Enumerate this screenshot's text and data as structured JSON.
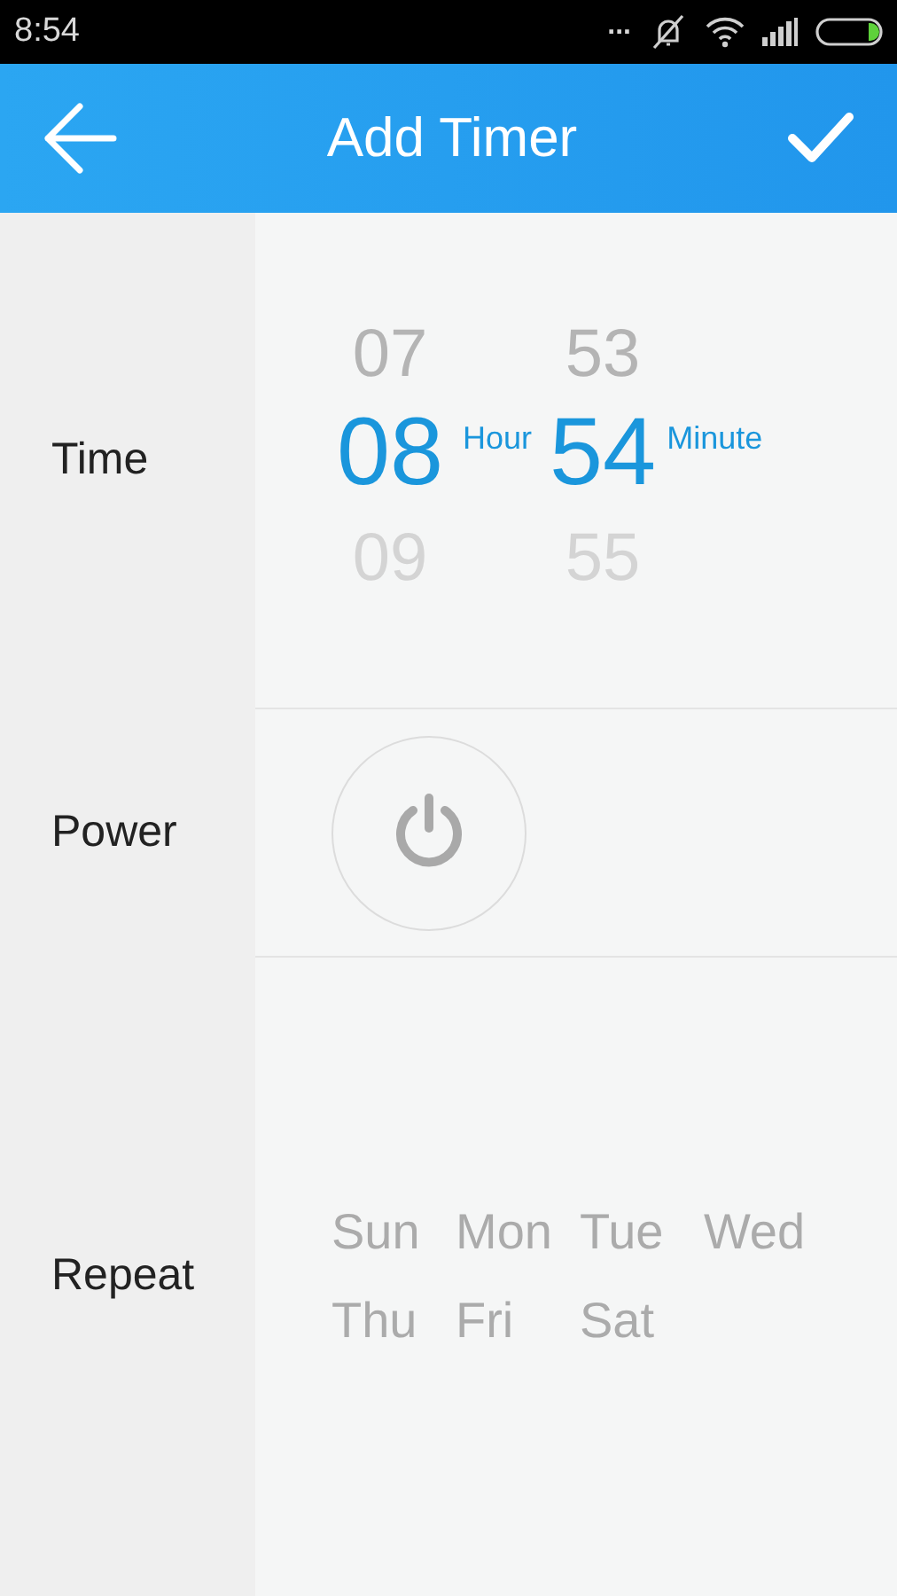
{
  "status_bar": {
    "time": "8:54",
    "more": "..."
  },
  "header": {
    "title": "Add Timer"
  },
  "sections": [
    {
      "kind": "time",
      "label": "Time",
      "columns": [
        {
          "unit": "Hour",
          "items": [
            {
              "text": "07",
              "selected": false
            },
            {
              "text": "08",
              "selected": true
            },
            {
              "text": "09",
              "selected": false
            }
          ]
        },
        {
          "unit": "Minute",
          "items": [
            {
              "text": "53",
              "selected": false
            },
            {
              "text": "54",
              "selected": true
            },
            {
              "text": "55",
              "selected": false
            }
          ]
        }
      ]
    },
    {
      "kind": "power",
      "label": "Power",
      "on": false
    },
    {
      "kind": "repeat",
      "label": "Repeat",
      "days": [
        {
          "text": "Sun",
          "selected": false
        },
        {
          "text": "Mon",
          "selected": false
        },
        {
          "text": "Tue",
          "selected": false
        },
        {
          "text": "Wed",
          "selected": false
        },
        {
          "text": "Thu",
          "selected": false
        },
        {
          "text": "Fri",
          "selected": false
        },
        {
          "text": "Sat",
          "selected": false
        }
      ]
    }
  ]
}
